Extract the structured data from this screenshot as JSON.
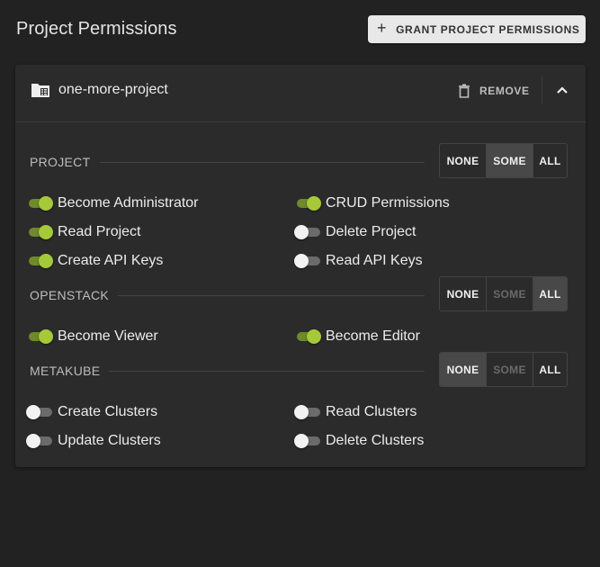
{
  "page": {
    "title": "Project Permissions",
    "grant_button_label": "GRANT PROJECT PERMISSIONS"
  },
  "colors": {
    "background": "#222222",
    "card": "#2b2b2b",
    "toggle_on_thumb": "#a6c93a",
    "toggle_on_track": "#6e8a2a",
    "toggle_off_thumb": "#f2f2f2",
    "toggle_off_track": "#6b6b6b"
  },
  "card": {
    "project_name": "one-more-project",
    "remove_label": "REMOVE",
    "icons": {
      "project": "folder-icon",
      "remove": "trash-icon",
      "collapse": "chevron-up-icon",
      "grant": "plus-icon"
    },
    "sections": [
      {
        "label": "PROJECT",
        "selector": {
          "options": [
            "NONE",
            "SOME",
            "ALL"
          ],
          "selected": "SOME",
          "disabled": []
        },
        "permissions": [
          {
            "label": "Become Administrator",
            "enabled": true
          },
          {
            "label": "CRUD Permissions",
            "enabled": true
          },
          {
            "label": "Read Project",
            "enabled": true
          },
          {
            "label": "Delete Project",
            "enabled": false
          },
          {
            "label": "Create API Keys",
            "enabled": true
          },
          {
            "label": "Read API Keys",
            "enabled": false
          }
        ]
      },
      {
        "label": "OPENSTACK",
        "selector": {
          "options": [
            "NONE",
            "SOME",
            "ALL"
          ],
          "selected": "ALL",
          "disabled": [
            "SOME"
          ]
        },
        "permissions": [
          {
            "label": "Become Viewer",
            "enabled": true
          },
          {
            "label": "Become Editor",
            "enabled": true
          }
        ]
      },
      {
        "label": "METAKUBE",
        "selector": {
          "options": [
            "NONE",
            "SOME",
            "ALL"
          ],
          "selected": "NONE",
          "disabled": [
            "SOME"
          ]
        },
        "permissions": [
          {
            "label": "Create Clusters",
            "enabled": false
          },
          {
            "label": "Read Clusters",
            "enabled": false
          },
          {
            "label": "Update Clusters",
            "enabled": false
          },
          {
            "label": "Delete Clusters",
            "enabled": false
          }
        ]
      }
    ]
  }
}
